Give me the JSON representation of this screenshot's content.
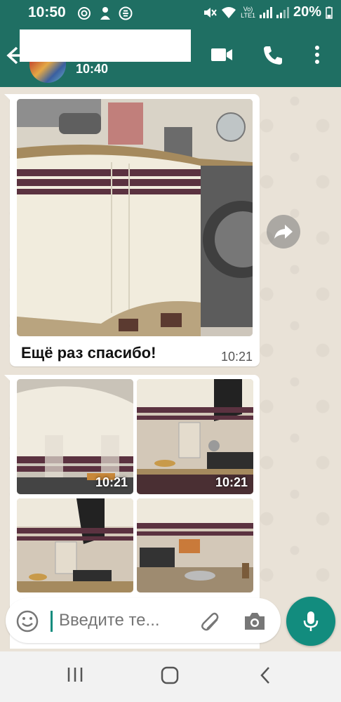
{
  "status_bar": {
    "time": "10:50",
    "left_icons": [
      "at-icon",
      "notification-icon",
      "e-app-icon"
    ],
    "volte_top": "Vo)",
    "volte_bottom": "LTE1",
    "battery": "20%"
  },
  "header": {
    "last_seen": "10:40",
    "actions": [
      "video-call-icon",
      "phone-icon",
      "more-vert-icon"
    ]
  },
  "messages": [
    {
      "type": "image_with_caption",
      "caption": "Ещё раз спасибо!",
      "time": "10:21"
    },
    {
      "type": "image_grid",
      "photos": [
        {
          "time": "10:21"
        },
        {
          "time": "10:21"
        },
        {
          "time": ""
        },
        {
          "time": ""
        }
      ]
    }
  ],
  "input": {
    "placeholder": "Введите те..."
  },
  "colors": {
    "primary": "#1f6f63",
    "accent": "#128c7e",
    "chat_bg": "#e9e2d7"
  }
}
